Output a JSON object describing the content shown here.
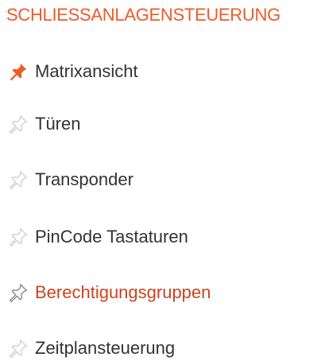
{
  "section": {
    "title": "SCHLIESSANLAGENSTEUERUNG"
  },
  "colors": {
    "accent": "#f05a28",
    "selected_text": "#c9441f",
    "pin_inactive": "#d0d0d0",
    "pin_active": "#f05a28",
    "pin_hover": "#8a8a8a"
  },
  "menu": {
    "items": [
      {
        "label": "Matrixansicht",
        "icon": "pin-icon",
        "pin_state": "active"
      },
      {
        "label": "Türen",
        "icon": "pin-icon",
        "pin_state": "inactive"
      },
      {
        "label": "Transponder",
        "icon": "pin-icon",
        "pin_state": "inactive"
      },
      {
        "label": "PinCode Tastaturen",
        "icon": "pin-icon",
        "pin_state": "inactive"
      },
      {
        "label": "Berechtigungsgruppen",
        "icon": "pin-icon",
        "pin_state": "hover"
      },
      {
        "label": "Zeitplansteuerung",
        "icon": "pin-icon",
        "pin_state": "inactive"
      }
    ]
  }
}
